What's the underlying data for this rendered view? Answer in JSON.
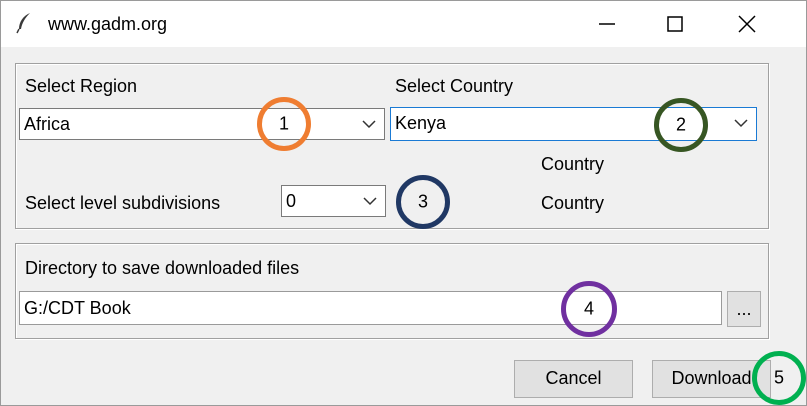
{
  "window": {
    "title": "www.gadm.org"
  },
  "region": {
    "label": "Select Region",
    "value": "Africa"
  },
  "country": {
    "label": "Select Country",
    "value": "Kenya"
  },
  "info": {
    "line1": "Country",
    "line2": "Country"
  },
  "subdivision": {
    "label": "Select level subdivisions",
    "value": "0"
  },
  "directory": {
    "label": "Directory to save downloaded files",
    "value": "G:/CDT Book",
    "browse_label": "..."
  },
  "buttons": {
    "cancel": "Cancel",
    "download": "Download"
  },
  "markers": [
    {
      "n": "1",
      "color": "#ef7d31"
    },
    {
      "n": "2",
      "color": "#375623"
    },
    {
      "n": "3",
      "color": "#203864"
    },
    {
      "n": "4",
      "color": "#7030a0"
    },
    {
      "n": "5",
      "color": "#00b050"
    }
  ],
  "icons": {
    "app": "feather-icon",
    "minimize": "minimize-icon",
    "maximize": "maximize-icon",
    "close": "close-icon",
    "dropdown": "chevron-down-icon"
  }
}
